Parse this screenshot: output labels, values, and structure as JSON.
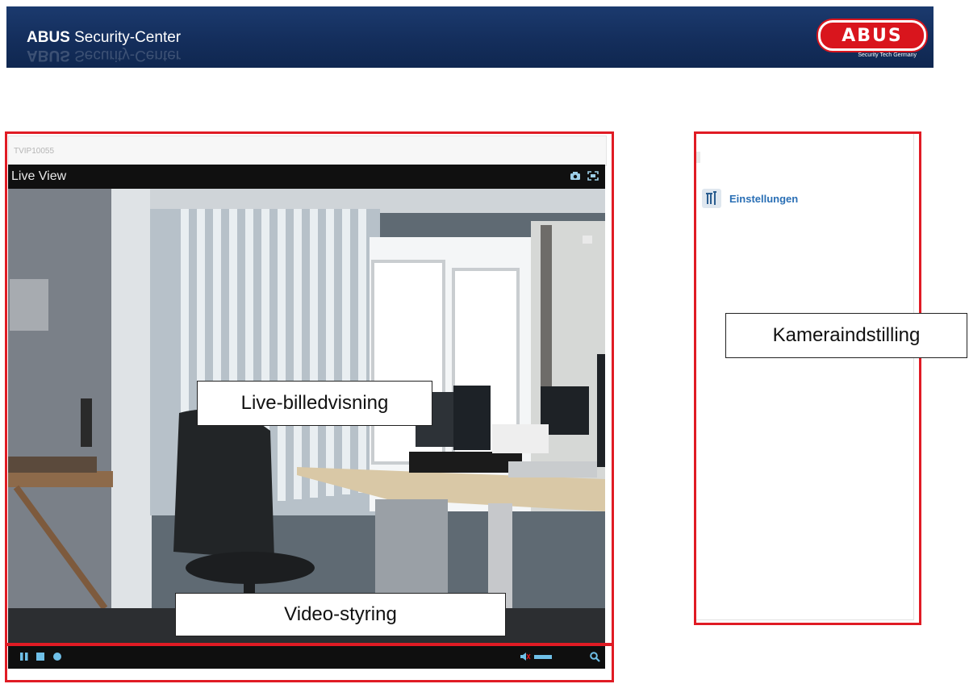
{
  "header": {
    "brand": "ABUS",
    "product": " Security-Center",
    "logo_text": "ABUS",
    "logo_tagline": "Security Tech Germany"
  },
  "live_panel": {
    "device_name": "TVIP10055",
    "title": "Live View",
    "icons": [
      "camera-snapshot-icon",
      "fullscreen-icon"
    ],
    "controls": [
      "pause-icon",
      "stop-icon",
      "record-icon",
      "audio-icon",
      "zoom-icon"
    ]
  },
  "settings_panel": {
    "item_label": "Einstellungen",
    "item_icon": "tools-icon"
  },
  "annotations": {
    "live_view": "Live-billedvisning",
    "video_control": "Video-styring",
    "camera_setting": "Kameraindstilling"
  },
  "colors": {
    "banner": "#142e5c",
    "highlight": "#e01b24",
    "logo_red": "#d9151d",
    "link_blue": "#2a6fb5"
  }
}
